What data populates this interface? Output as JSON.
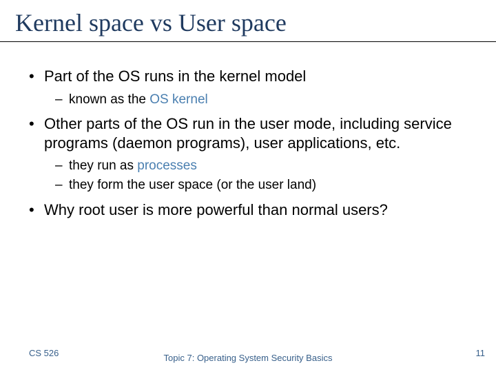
{
  "title": "Kernel space vs User space",
  "bullets": {
    "b1": "Part of the OS runs in the kernel model",
    "b1a_pre": "known as the ",
    "b1a_accent": "OS kernel",
    "b2": "Other parts of the OS run in the user mode, including service programs (daemon programs), user applications, etc.",
    "b2a_pre": "they run as ",
    "b2a_accent": "processes",
    "b2b": "they form the user space (or the user land)",
    "b3": "Why root user is more powerful than normal users?"
  },
  "footer": {
    "left": "CS 526",
    "center": "Topic 7: Operating System Security Basics",
    "right": "11"
  }
}
